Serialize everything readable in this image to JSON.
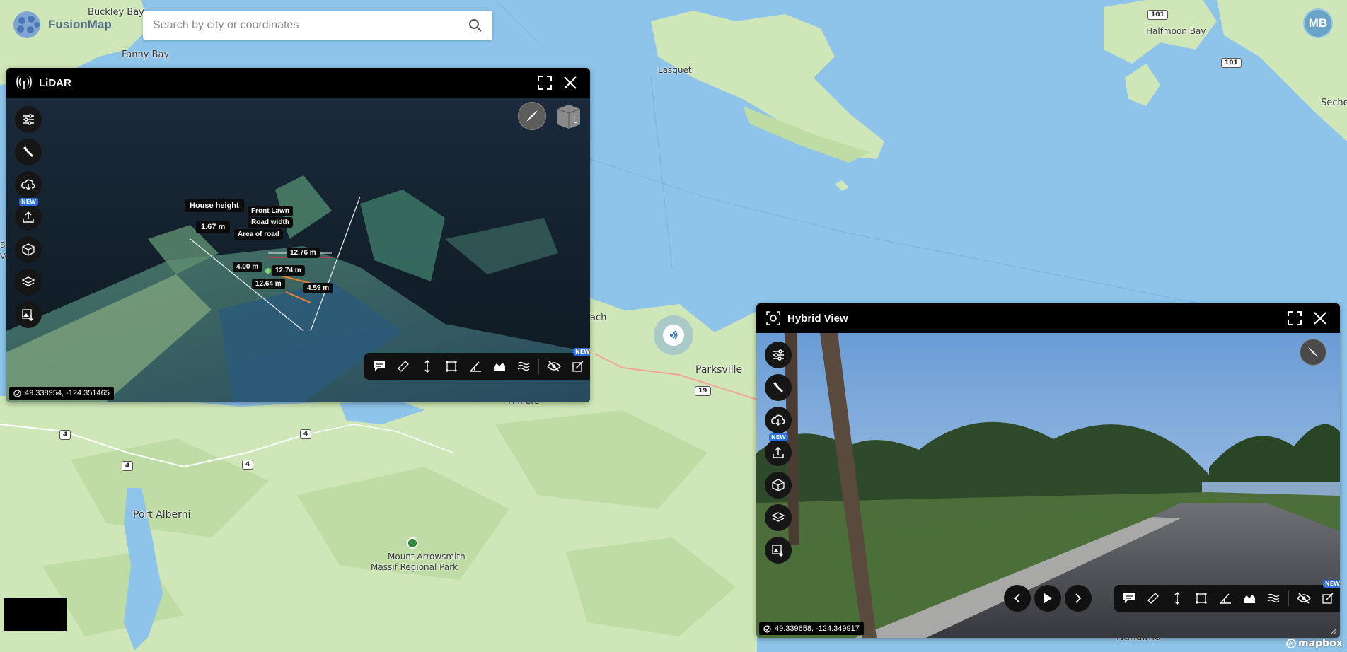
{
  "app": {
    "name": "FusionMap",
    "user_initials": "MB"
  },
  "search": {
    "placeholder": "Search by city or coordinates"
  },
  "map": {
    "labels": [
      "Buckley Bay",
      "Fanny Bay",
      "Lasqueti",
      "Halfmoon Bay",
      "Seche",
      "Parksville",
      "Port Alberni",
      "Mount Arrowsmith",
      "Massif Regional Park",
      "Nanaimo",
      "Hilliers",
      "ach",
      "B",
      "Vo"
    ],
    "shields": [
      "101",
      "101",
      "19",
      "4",
      "4",
      "4",
      "4"
    ],
    "attribution": "mapbox"
  },
  "lidar": {
    "title": "LiDAR",
    "coords": "49.338954, -124.351465",
    "side_tools": [
      "settings",
      "tools",
      "cloud-download",
      "upload",
      "cube",
      "layers",
      "image-download"
    ],
    "new_badge": "NEW",
    "measurements": {
      "house_height": "House height",
      "house_height_val": "1.67 m",
      "front_lawn": "Front Lawn",
      "road_width": "Road width",
      "area_of_road": "Area of road",
      "m1": "12.76 m",
      "m2": "4.00 m",
      "m3": "12.74 m",
      "m4": "12.64 m",
      "m5": "4.59 m"
    },
    "viewcube_label": "L"
  },
  "hybrid": {
    "title": "Hybrid View",
    "coords": "49.339658, -124.349917",
    "new_badge": "NEW"
  },
  "colors": {
    "accent": "#2a6ee0",
    "map_land": "#cfe7b8",
    "map_water": "#8fc4ea"
  }
}
